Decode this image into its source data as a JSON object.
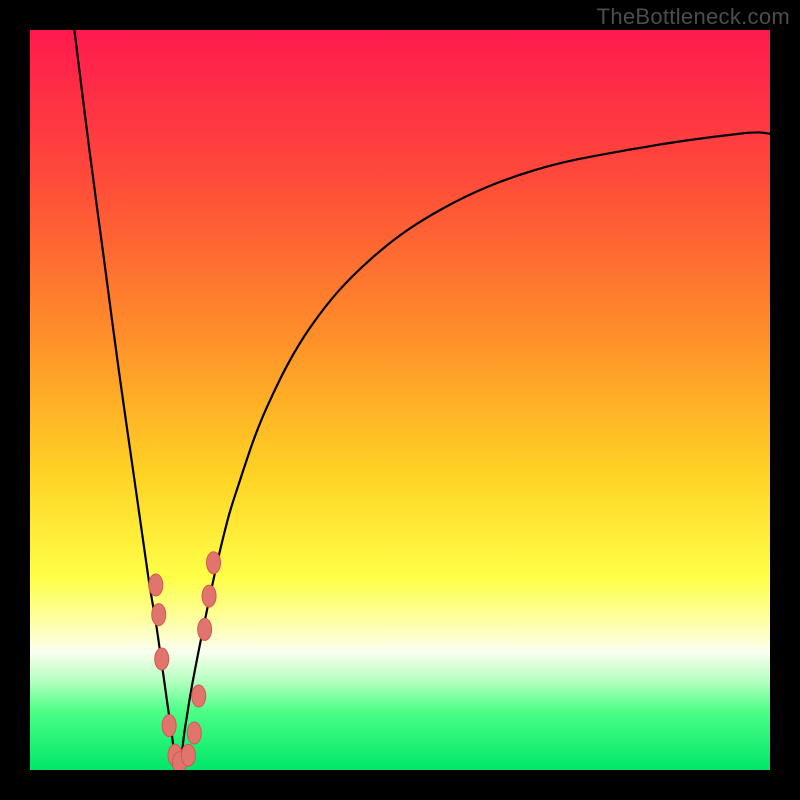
{
  "watermark": "TheBottleneck.com",
  "colors": {
    "frame": "#000000",
    "curve": "#000000",
    "marker_fill": "#e0756e",
    "marker_stroke": "#d3574f",
    "gradient_stops": [
      {
        "offset": 0.0,
        "color": "#ff1a4e"
      },
      {
        "offset": 0.2,
        "color": "#ff4a3a"
      },
      {
        "offset": 0.4,
        "color": "#ff8a2a"
      },
      {
        "offset": 0.6,
        "color": "#ffd324"
      },
      {
        "offset": 0.74,
        "color": "#ffff47"
      },
      {
        "offset": 0.8,
        "color": "#ffffa6"
      },
      {
        "offset": 0.84,
        "color": "#fafff0"
      },
      {
        "offset": 0.88,
        "color": "#b5ffbf"
      },
      {
        "offset": 0.92,
        "color": "#4dff87"
      },
      {
        "offset": 1.0,
        "color": "#00e66a"
      }
    ]
  },
  "chart_data": {
    "type": "line",
    "title": "",
    "xlabel": "",
    "ylabel": "",
    "xlim": [
      0,
      100
    ],
    "ylim": [
      0,
      100
    ],
    "notch_x": 20,
    "series": [
      {
        "name": "bottleneck-curve",
        "x": [
          6,
          8,
          10,
          12,
          14,
          16,
          17,
          18,
          19,
          20,
          21,
          22,
          24,
          26,
          28,
          32,
          38,
          46,
          56,
          68,
          82,
          96,
          100
        ],
        "values": [
          100,
          84,
          69,
          54,
          40,
          26,
          20,
          13,
          6,
          0,
          6,
          12,
          22,
          31,
          38,
          49,
          60,
          69,
          76,
          81,
          84,
          86,
          86
        ]
      }
    ],
    "markers": {
      "name": "data-points",
      "x": [
        17.0,
        17.4,
        17.8,
        18.8,
        19.6,
        20.2,
        21.4,
        22.2,
        22.8,
        23.6,
        24.2,
        24.8
      ],
      "values": [
        25.0,
        21.0,
        15.0,
        6.0,
        2.0,
        1.0,
        2.0,
        5.0,
        10.0,
        19.0,
        23.5,
        28.0
      ],
      "rx": 7,
      "ry": 11
    }
  }
}
